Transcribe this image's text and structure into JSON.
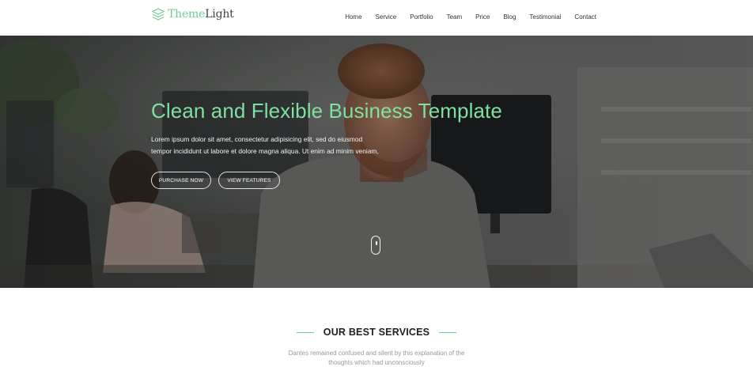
{
  "header": {
    "logo": {
      "part1": "Theme",
      "part2": "Light",
      "icon": "layers-icon"
    },
    "nav": [
      "Home",
      "Service",
      "Portfolio",
      "Team",
      "Price",
      "Blog",
      "Testimonial",
      "Contact"
    ]
  },
  "hero": {
    "title": "Clean and Flexible Business Template",
    "text_line1": "Lorem ipsum dolor sit amet, consectetur adipisicing elit, sed do eiusmod",
    "text_line2": "tempor incididunt ut labore et dolore magna aliqua. Ut enim ad minim veniam,",
    "buttons": {
      "primary": "PURCHASE NOW",
      "secondary": "VIEW FEATURES"
    },
    "scroll_icon": "mouse-scroll-icon"
  },
  "services": {
    "title": "OUR BEST SERVICES",
    "desc_line1": "Dantes remained confused and silent by this explanation of the",
    "desc_line2": "thoughts which had unconsciously"
  },
  "colors": {
    "accent": "#6fcf8f",
    "hero_title": "#7fe0a0"
  }
}
